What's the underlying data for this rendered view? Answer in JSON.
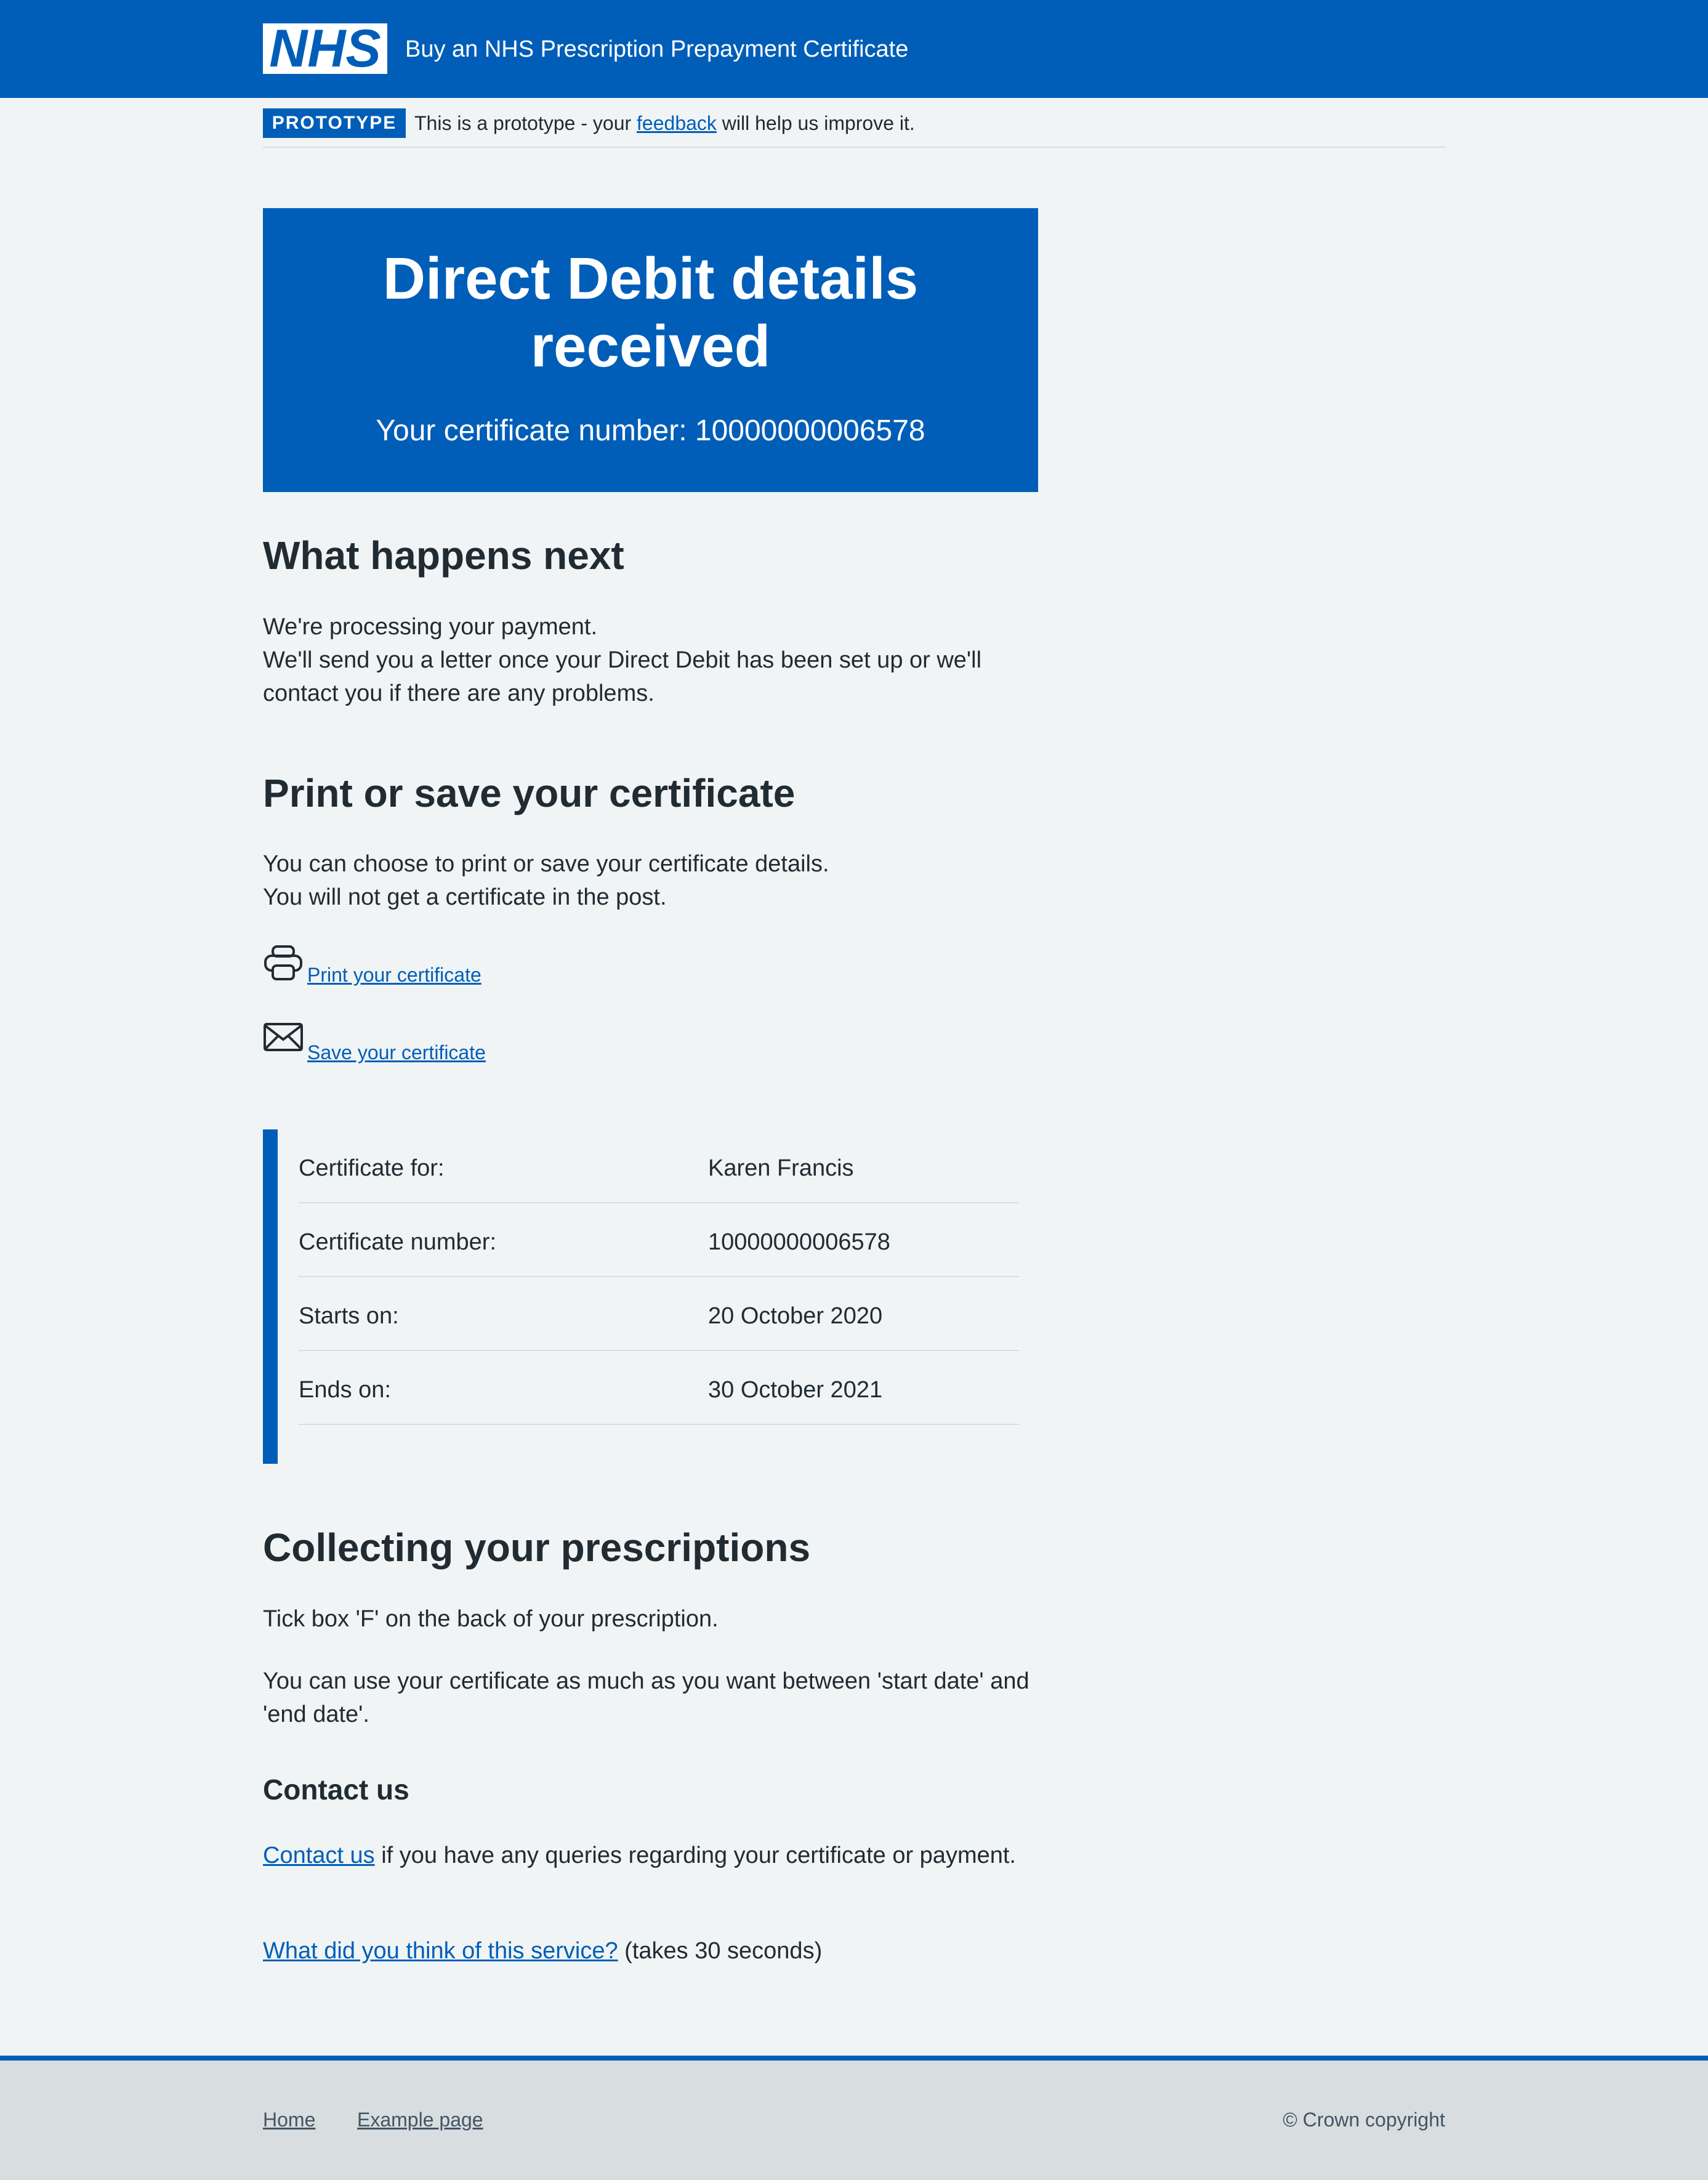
{
  "header": {
    "logo_text": "NHS",
    "service_name": "Buy an NHS Prescription Prepayment Certificate"
  },
  "prototype_banner": {
    "tag": "PROTOTYPE",
    "text_before": "This is a prototype - your ",
    "link": "feedback",
    "text_after": " will help us improve it."
  },
  "panel": {
    "title_line1": "Direct Debit details",
    "title_line2": "received",
    "subtitle": "Your certificate number: 10000000006578"
  },
  "what_next": {
    "heading": "What happens next",
    "line1": "We're processing your payment.",
    "line2": "We'll send you a letter once your Direct Debit has been set up or we'll contact you if there are any problems."
  },
  "print_save": {
    "heading": "Print or save your certificate",
    "line1": "You can choose to print or save your certificate details.",
    "line2": "You will not get a certificate in the post.",
    "print_link": "Print your certificate",
    "save_link": "Save your certificate",
    "print_icon": "printer-icon",
    "save_icon": "envelope-icon"
  },
  "certificate": {
    "rows": [
      {
        "key": "Certificate for:",
        "value": "Karen Francis"
      },
      {
        "key": "Certificate number:",
        "value": "10000000006578"
      },
      {
        "key": "Starts on:",
        "value": "20 October 2020"
      },
      {
        "key": "Ends on:",
        "value": "30 October 2021"
      }
    ]
  },
  "collecting": {
    "heading": "Collecting your prescriptions",
    "para1": "Tick box 'F' on the back of your prescription.",
    "para2": "You can use your certificate as much as you want between 'start date' and 'end date'."
  },
  "contact": {
    "heading": "Contact us",
    "link": "Contact us",
    "text": " if you have any queries regarding your certificate or payment.",
    "survey_link": "What did you think of this service?",
    "survey_note": " (takes 30 seconds)"
  },
  "footer": {
    "links": [
      "Home",
      "Example page"
    ],
    "copyright": "© Crown copyright"
  },
  "colors": {
    "brand_blue": "#005eb8",
    "page_bg": "#f0f4f5",
    "text": "#212b32",
    "footer_bg": "#d8dde0",
    "footer_text": "#425563"
  }
}
